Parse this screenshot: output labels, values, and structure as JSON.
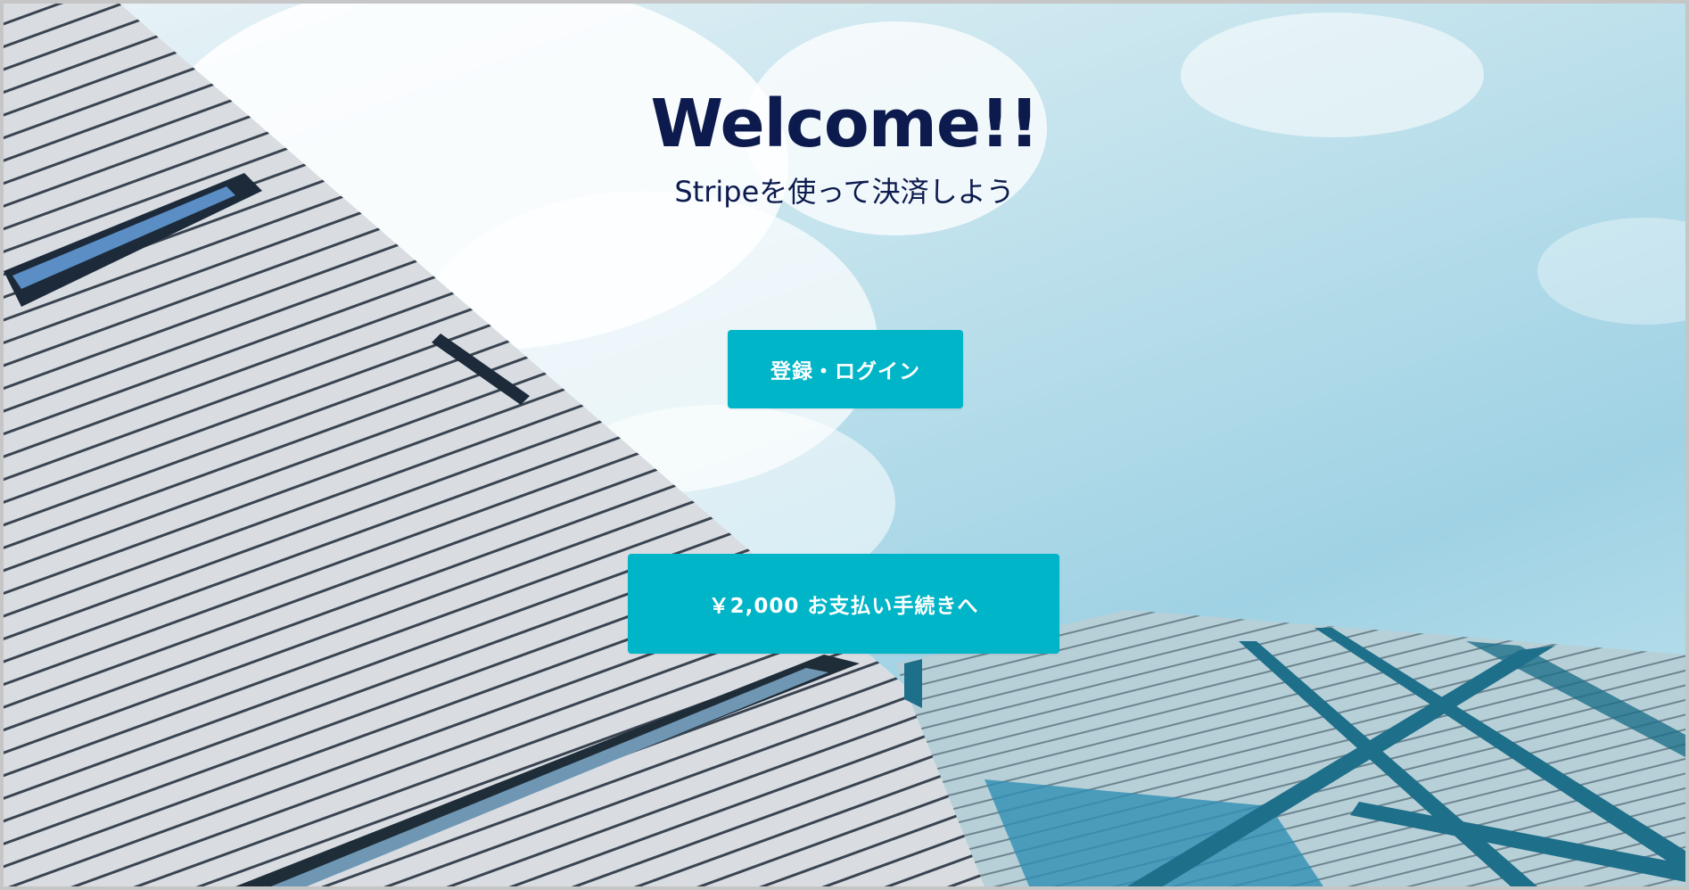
{
  "hero": {
    "title": "Welcome!!",
    "subtitle": "Stripeを使って決済しよう"
  },
  "buttons": {
    "login_label": "登録・ログイン",
    "pay_label": "￥2,000 お支払い手続きへ"
  },
  "colors": {
    "title_text": "#0c1a4d",
    "button_background": "#00b5c7",
    "button_text": "#ffffff"
  }
}
